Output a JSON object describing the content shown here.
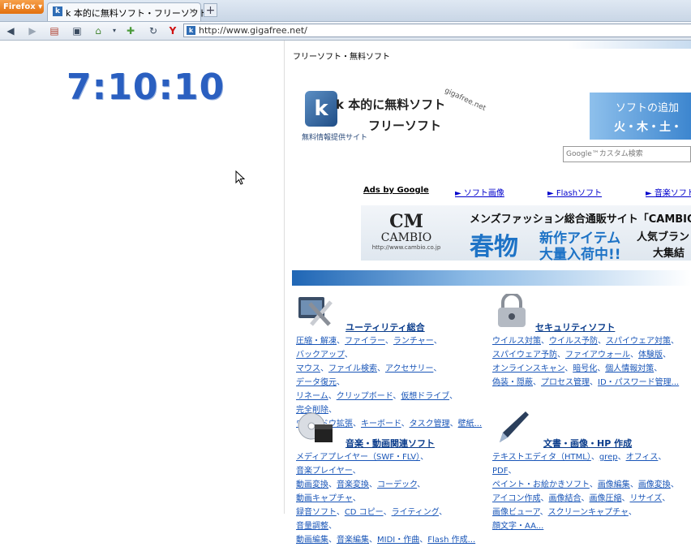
{
  "browser": {
    "menu_button": "Firefox ▾",
    "tab_title": "k 本的に無料ソフト・フリーソフト",
    "tab_close": "×",
    "new_tab": "+",
    "url": "http://www.gigafree.net/"
  },
  "clock": {
    "time": "7:10:10"
  },
  "site": {
    "subtitle": "フリーソフト・無料ソフト",
    "logo_line1": "k 本的に無料ソフト",
    "logo_line2": "フリーソフト",
    "logo_domain": "gigafree.net",
    "logo_tagline": "無料情報提供サイト",
    "banner_line1": "ソフトの追加",
    "banner_line2": "火・木・土・",
    "search_placeholder": "Google™カスタム検索"
  },
  "ads": {
    "label": "Ads by Google",
    "links": [
      "► ソフト画像",
      "► Flashソフト",
      "► 音楽ソフト"
    ],
    "banner": {
      "brand": "CAMBIO",
      "url": "http://www.cambio.co.jp",
      "headline": "メンズファッション総合通販サイト「CAMBIO",
      "big": "春物",
      "line1": "新作アイテム",
      "line2": "大量入荷中!!",
      "right1": "人気ブランド",
      "right2": "大集結"
    }
  },
  "categories": [
    {
      "title": "ユーティリティ総合",
      "links": [
        "圧縮・解凍",
        "ファイラー",
        "ランチャー",
        "バックアップ",
        "マウス",
        "ファイル検索",
        "アクセサリー",
        "データ復元",
        "リネーム",
        "クリップボード",
        "仮想ドライブ",
        "完全削除",
        "ウィンドウ拡張",
        "キーボード",
        "タスク管理",
        "壁紙..."
      ]
    },
    {
      "title": "セキュリティソフト",
      "links": [
        "ウイルス対策",
        "ウイルス予防",
        "スパイウェア対策",
        "スパイウェア予防",
        "ファイアウォール",
        "体験版",
        "オンラインスキャン",
        "暗号化",
        "個人情報対策",
        "偽装・隠蔽",
        "プロセス管理",
        "ID・パスワード管理..."
      ]
    },
    {
      "title": "音楽・動画関連ソフト",
      "links": [
        "メディアプレイヤー（SWF・FLV）",
        "音楽プレイヤー",
        "動画変換",
        "音楽変換",
        "コーデック",
        "動画キャプチャ",
        "録音ソフト",
        "CD コピー",
        "ライティング",
        "音量調整",
        "動画編集",
        "音楽編集",
        "MIDI・作曲",
        "Flash 作成..."
      ]
    },
    {
      "title": "文書・画像・HP 作成",
      "links": [
        "テキストエディタ（HTML）",
        "grep",
        "オフィス",
        "PDF",
        "ペイント・お絵かきソフト",
        "画像編集",
        "画像変換",
        "アイコン作成",
        "画像結合",
        "画像圧縮",
        "リサイズ",
        "画像ビューア",
        "スクリーンキャプチャ",
        "顔文字・AA..."
      ]
    }
  ]
}
